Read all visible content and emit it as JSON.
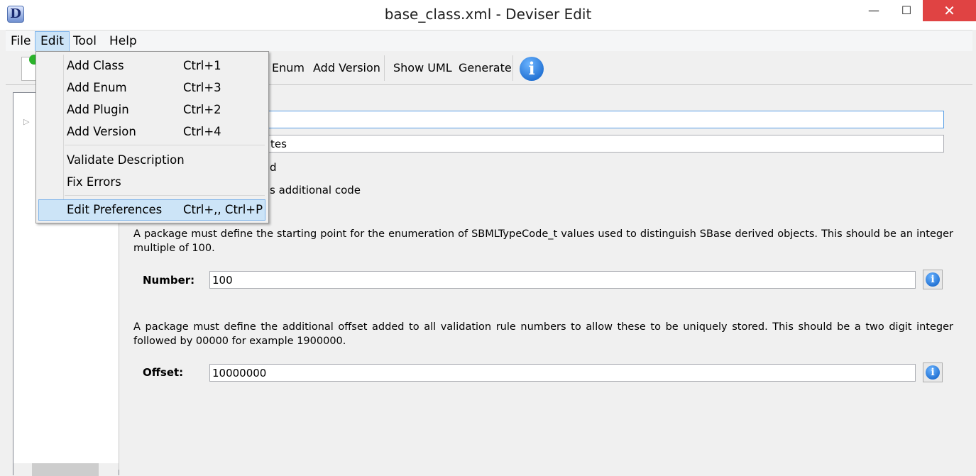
{
  "window": {
    "title": "base_class.xml - Deviser Edit",
    "app_icon": "D",
    "controls": {
      "minimize": "—",
      "maximize": "☐",
      "close": "✕"
    }
  },
  "menubar": {
    "items": [
      "File",
      "Edit",
      "Tool",
      "Help"
    ],
    "open": "Edit"
  },
  "toolbar": {
    "items": [
      "Enum",
      "Add Version",
      "Show UML",
      "Generate"
    ],
    "icons": [
      "new-document-icon",
      "info-icon"
    ]
  },
  "edit_menu": {
    "items": [
      {
        "label": "Add Class",
        "shortcut": "Ctrl+1"
      },
      {
        "label": "Add Enum",
        "shortcut": "Ctrl+3"
      },
      {
        "label": "Add Plugin",
        "shortcut": "Ctrl+2"
      },
      {
        "label": "Add Version",
        "shortcut": "Ctrl+4"
      },
      {
        "label": "Validate Description",
        "shortcut": ""
      },
      {
        "label": "Fix Errors",
        "shortcut": ""
      },
      {
        "label": "Edit Preferences",
        "shortcut": "Ctrl+,, Ctrl+P",
        "highlighted": true
      }
    ]
  },
  "form": {
    "field2_partial": "tes",
    "check1_partial": "d",
    "check2_partial": "s additional code",
    "typecode_desc": "A package must define the starting point for the enumeration of SBMLTypeCode_t values used to distinguish SBase derived objects. This should be an integer multiple of 100.",
    "number_label": "Number:",
    "number_value": "100",
    "offset_desc": "A package must define the additional offset added to all validation rule numbers to allow these to be uniquely stored. This should be a two digit integer followed by 00000 for example 1900000.",
    "offset_label": "Offset:",
    "offset_value": "10000000",
    "info_glyph": "i"
  },
  "colors": {
    "accent": "#cce4f7",
    "close": "#e04343",
    "info": "#0a5bc4"
  }
}
